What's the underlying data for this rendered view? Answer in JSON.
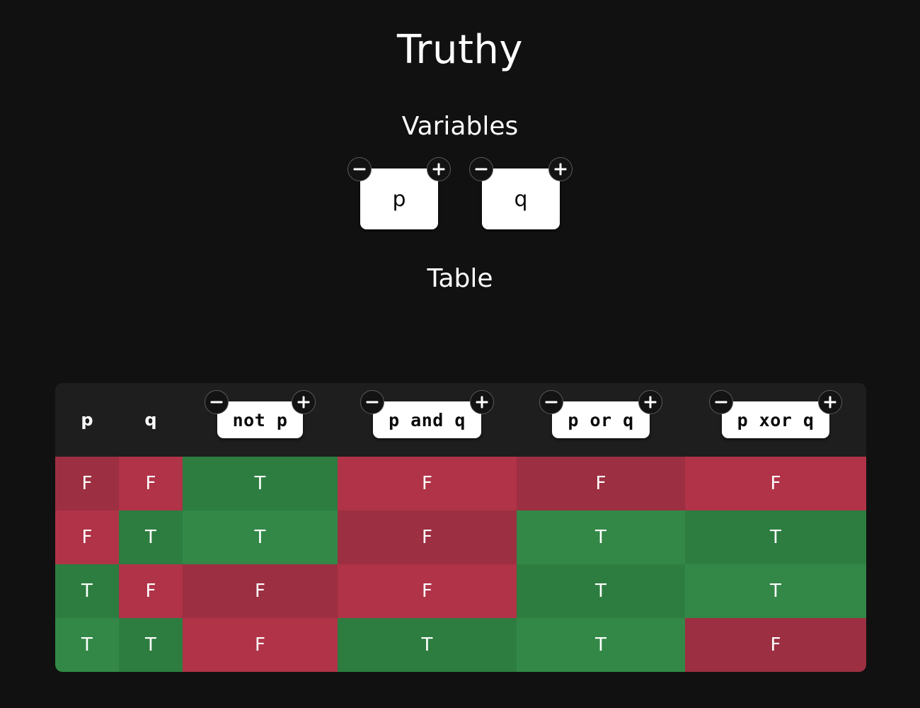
{
  "app": {
    "title": "Truthy",
    "background_color": "#111111",
    "panel_color": "#1e1e1e"
  },
  "sections": {
    "variables_title": "Variables",
    "table_title": "Table"
  },
  "controls": {
    "minus_label": "−",
    "plus_label": "+",
    "minus_icon": "minus-circle-icon",
    "plus_icon": "plus-circle-icon"
  },
  "variables": [
    {
      "name": "p"
    },
    {
      "name": "q"
    }
  ],
  "colors": {
    "true_dark": "#2d7d40",
    "true_light": "#338848",
    "false_dark": "#9c2f41",
    "false_light": "#b03348",
    "chip_bg": "#ffffff",
    "chip_text": "#0a0a0a"
  },
  "chart_data": {
    "type": "table",
    "title": "Table",
    "columns": [
      {
        "label": "p",
        "kind": "variable",
        "editable": false
      },
      {
        "label": "q",
        "kind": "variable",
        "editable": false
      },
      {
        "label": "not p",
        "kind": "expression",
        "editable": true
      },
      {
        "label": "p and q",
        "kind": "expression",
        "editable": true
      },
      {
        "label": "p or q",
        "kind": "expression",
        "editable": true
      },
      {
        "label": "p xor q",
        "kind": "expression",
        "editable": true
      }
    ],
    "rows": [
      {
        "cells": [
          "F",
          "F",
          "T",
          "F",
          "F",
          "F"
        ]
      },
      {
        "cells": [
          "F",
          "T",
          "T",
          "F",
          "T",
          "T"
        ]
      },
      {
        "cells": [
          "T",
          "F",
          "F",
          "F",
          "T",
          "T"
        ]
      },
      {
        "cells": [
          "T",
          "T",
          "F",
          "T",
          "T",
          "F"
        ]
      }
    ],
    "legend": {
      "T": "true",
      "F": "false"
    },
    "true_token": "T",
    "false_token": "F"
  }
}
